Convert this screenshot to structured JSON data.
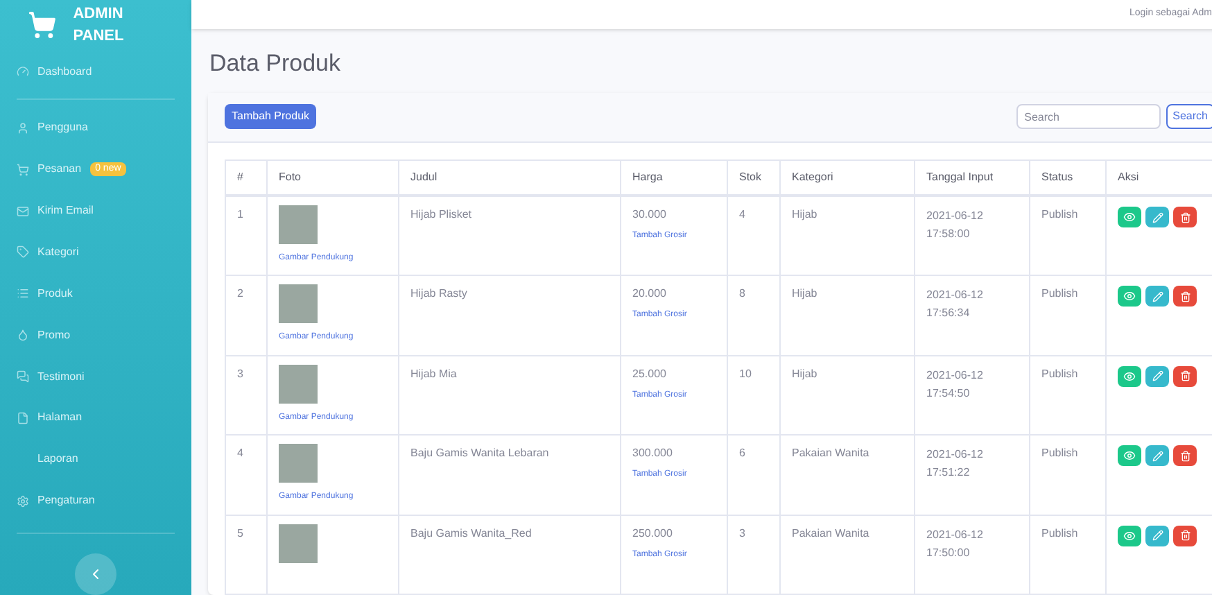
{
  "sidebar": {
    "brand": "ADMIN PANEL",
    "items": [
      {
        "label": "Dashboard"
      },
      {
        "label": "Pengguna"
      },
      {
        "label": "Pesanan",
        "badge": "0 new"
      },
      {
        "label": "Kirim Email"
      },
      {
        "label": "Kategori"
      },
      {
        "label": "Produk"
      },
      {
        "label": "Promo"
      },
      {
        "label": "Testimoni"
      },
      {
        "label": "Halaman"
      },
      {
        "label": "Laporan"
      },
      {
        "label": "Pengaturan"
      }
    ]
  },
  "topbar": {
    "user_text": "Login sebagai Adm"
  },
  "page_title": "Data Produk",
  "toolbar": {
    "add_button": "Tambah Produk",
    "search": {
      "placeholder": "Search"
    },
    "search_button": "Search"
  },
  "table": {
    "columns": [
      "#",
      "Foto",
      "Judul",
      "Harga",
      "Stok",
      "Kategori",
      "Tanggal Input",
      "Status",
      "Aksi"
    ],
    "rows": [
      {
        "no": "1",
        "photo_link": "Gambar Pendukung",
        "title": "Hijab Plisket",
        "price": "30.000",
        "price_link": "Tambah Grosir",
        "stock": "4",
        "category": "Hijab",
        "date": "2021-06-12",
        "time": "17:58:00",
        "status": "Publish"
      },
      {
        "no": "2",
        "photo_link": "Gambar Pendukung",
        "title": "Hijab Rasty",
        "price": "20.000",
        "price_link": "Tambah Grosir",
        "stock": "8",
        "category": "Hijab",
        "date": "2021-06-12",
        "time": "17:56:34",
        "status": "Publish"
      },
      {
        "no": "3",
        "photo_link": "Gambar Pendukung",
        "title": "Hijab Mia",
        "price": "25.000",
        "price_link": "Tambah Grosir",
        "stock": "10",
        "category": "Hijab",
        "date": "2021-06-12",
        "time": "17:54:50",
        "status": "Publish"
      },
      {
        "no": "4",
        "photo_link": "Gambar Pendukung",
        "title": "Baju Gamis Wanita Lebaran",
        "price": "300.000",
        "price_link": "Tambah Grosir",
        "stock": "6",
        "category": "Pakaian Wanita",
        "date": "2021-06-12",
        "time": "17:51:22",
        "status": "Publish"
      },
      {
        "no": "5",
        "title": "Baju Gamis Wanita_Red",
        "price": "250.000",
        "price_link": "Tambah Grosir",
        "stock": "3",
        "category": "Pakaian Wanita",
        "date": "2021-06-12",
        "time": "17:50:00",
        "status": "Publish"
      }
    ]
  }
}
